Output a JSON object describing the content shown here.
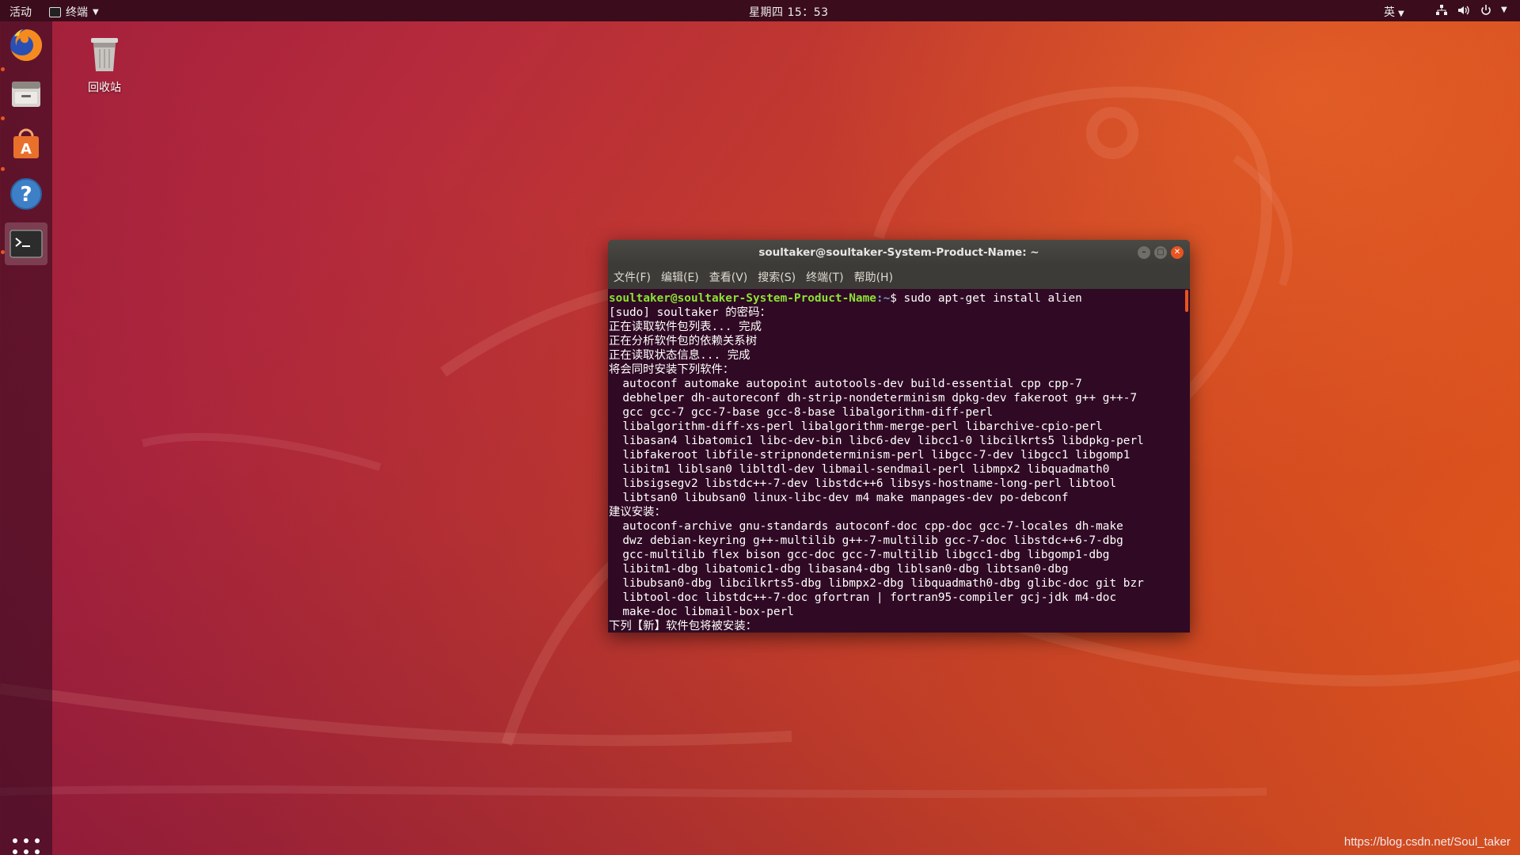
{
  "topbar": {
    "activities": "活动",
    "app_menu": "终端",
    "clock": "星期四 15：53",
    "ime": "英",
    "status_icons": [
      "network-icon",
      "volume-icon",
      "power-icon",
      "chevron-down-icon"
    ]
  },
  "dock": {
    "items": [
      {
        "name": "firefox-icon",
        "running": true
      },
      {
        "name": "files-icon",
        "running": true
      },
      {
        "name": "software-center-icon",
        "running": true
      },
      {
        "name": "help-icon",
        "running": false
      },
      {
        "name": "terminal-icon",
        "running": true,
        "active": true
      }
    ],
    "show_apps": "apps-grid-icon"
  },
  "desktop": {
    "trash_label": "回收站"
  },
  "terminal": {
    "title": "soultaker@soultaker-System-Product-Name: ~",
    "menu": [
      "文件(F)",
      "编辑(E)",
      "查看(V)",
      "搜索(S)",
      "终端(T)",
      "帮助(H)"
    ],
    "prompt_user": "soultaker@soultaker-System-Product-Name",
    "prompt_path": ":~",
    "prompt_tail": "$ sudo apt-get install alien",
    "lines": [
      "[sudo] soultaker 的密码：",
      "正在读取软件包列表... 完成",
      "正在分析软件包的依赖关系树",
      "正在读取状态信息... 完成",
      "将会同时安装下列软件：",
      "  autoconf automake autopoint autotools-dev build-essential cpp cpp-7",
      "  debhelper dh-autoreconf dh-strip-nondeterminism dpkg-dev fakeroot g++ g++-7",
      "  gcc gcc-7 gcc-7-base gcc-8-base libalgorithm-diff-perl",
      "  libalgorithm-diff-xs-perl libalgorithm-merge-perl libarchive-cpio-perl",
      "  libasan4 libatomic1 libc-dev-bin libc6-dev libcc1-0 libcilkrts5 libdpkg-perl",
      "  libfakeroot libfile-stripnondeterminism-perl libgcc-7-dev libgcc1 libgomp1",
      "  libitm1 liblsan0 libltdl-dev libmail-sendmail-perl libmpx2 libquadmath0",
      "  libsigsegv2 libstdc++-7-dev libstdc++6 libsys-hostname-long-perl libtool",
      "  libtsan0 libubsan0 linux-libc-dev m4 make manpages-dev po-debconf",
      "建议安装：",
      "  autoconf-archive gnu-standards autoconf-doc cpp-doc gcc-7-locales dh-make",
      "  dwz debian-keyring g++-multilib g++-7-multilib gcc-7-doc libstdc++6-7-dbg",
      "  gcc-multilib flex bison gcc-doc gcc-7-multilib libgcc1-dbg libgomp1-dbg",
      "  libitm1-dbg libatomic1-dbg libasan4-dbg liblsan0-dbg libtsan0-dbg",
      "  libubsan0-dbg libcilkrts5-dbg libmpx2-dbg libquadmath0-dbg glibc-doc git bzr",
      "  libtool-doc libstdc++-7-doc gfortran | fortran95-compiler gcj-jdk m4-doc",
      "  make-doc libmail-box-perl",
      "下列【新】软件包将被安装："
    ]
  },
  "watermark": "https://blog.csdn.net/Soul_taker"
}
